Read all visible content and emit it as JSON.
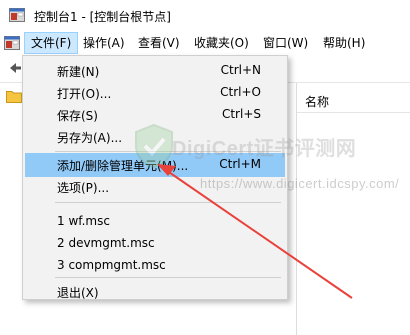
{
  "window": {
    "title": "控制台1 - [控制台根节点]"
  },
  "menubar": {
    "items": [
      {
        "label": "文件(F)"
      },
      {
        "label": "操作(A)"
      },
      {
        "label": "查看(V)"
      },
      {
        "label": "收藏夹(O)"
      },
      {
        "label": "窗口(W)"
      },
      {
        "label": "帮助(H)"
      }
    ]
  },
  "right_pane": {
    "column_header": "名称"
  },
  "file_menu": {
    "items": [
      {
        "label": "新建(N)",
        "shortcut": "Ctrl+N"
      },
      {
        "label": "打开(O)...",
        "shortcut": "Ctrl+O"
      },
      {
        "label": "保存(S)",
        "shortcut": "Ctrl+S"
      },
      {
        "label": "另存为(A)...",
        "shortcut": ""
      },
      {
        "label": "添加/删除管理单元(M)...",
        "shortcut": "Ctrl+M"
      },
      {
        "label": "选项(P)...",
        "shortcut": ""
      },
      {
        "label": "1 wf.msc",
        "shortcut": ""
      },
      {
        "label": "2 devmgmt.msc",
        "shortcut": ""
      },
      {
        "label": "3 compmgmt.msc",
        "shortcut": ""
      },
      {
        "label": "退出(X)",
        "shortcut": ""
      }
    ]
  },
  "watermark": {
    "main": "DigiCert证书评测网",
    "sub": "https://www.digicert.idcspy.com/"
  },
  "colors": {
    "highlight": "#91c9f7",
    "menu_active": "#cce8ff",
    "arrow": "#e8423b"
  }
}
